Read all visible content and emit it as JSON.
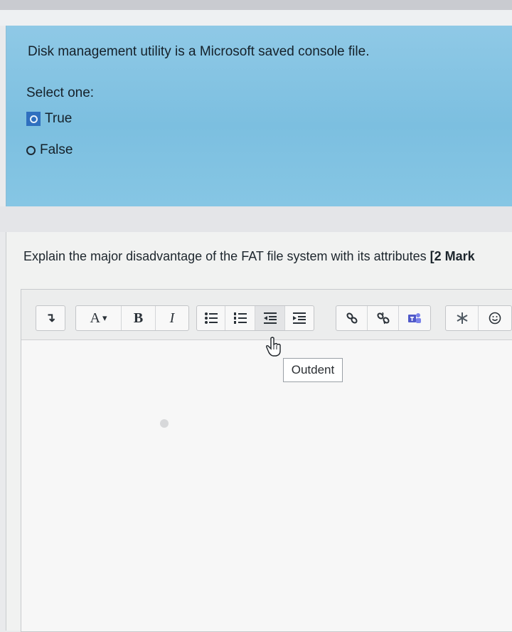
{
  "question1": {
    "text": "Disk management utility is a Microsoft saved console file.",
    "select_label": "Select one:",
    "options": [
      {
        "label": "True",
        "selected": true
      },
      {
        "label": "False",
        "selected": false
      }
    ]
  },
  "question2": {
    "text": "Explain the major disadvantage of the FAT file system with its attributes ",
    "marks": "[2 Mark"
  },
  "toolbar": {
    "collapse_icon": "↴",
    "font_color_label": "A",
    "dropdown_glyph": "▾",
    "bold_label": "B",
    "italic_label": "I",
    "tooltip": "Outdent"
  },
  "colors": {
    "question_bg": "#86c6e4",
    "selected_radio": "#2f6fbf",
    "editor_bg": "#f7f7f7"
  }
}
